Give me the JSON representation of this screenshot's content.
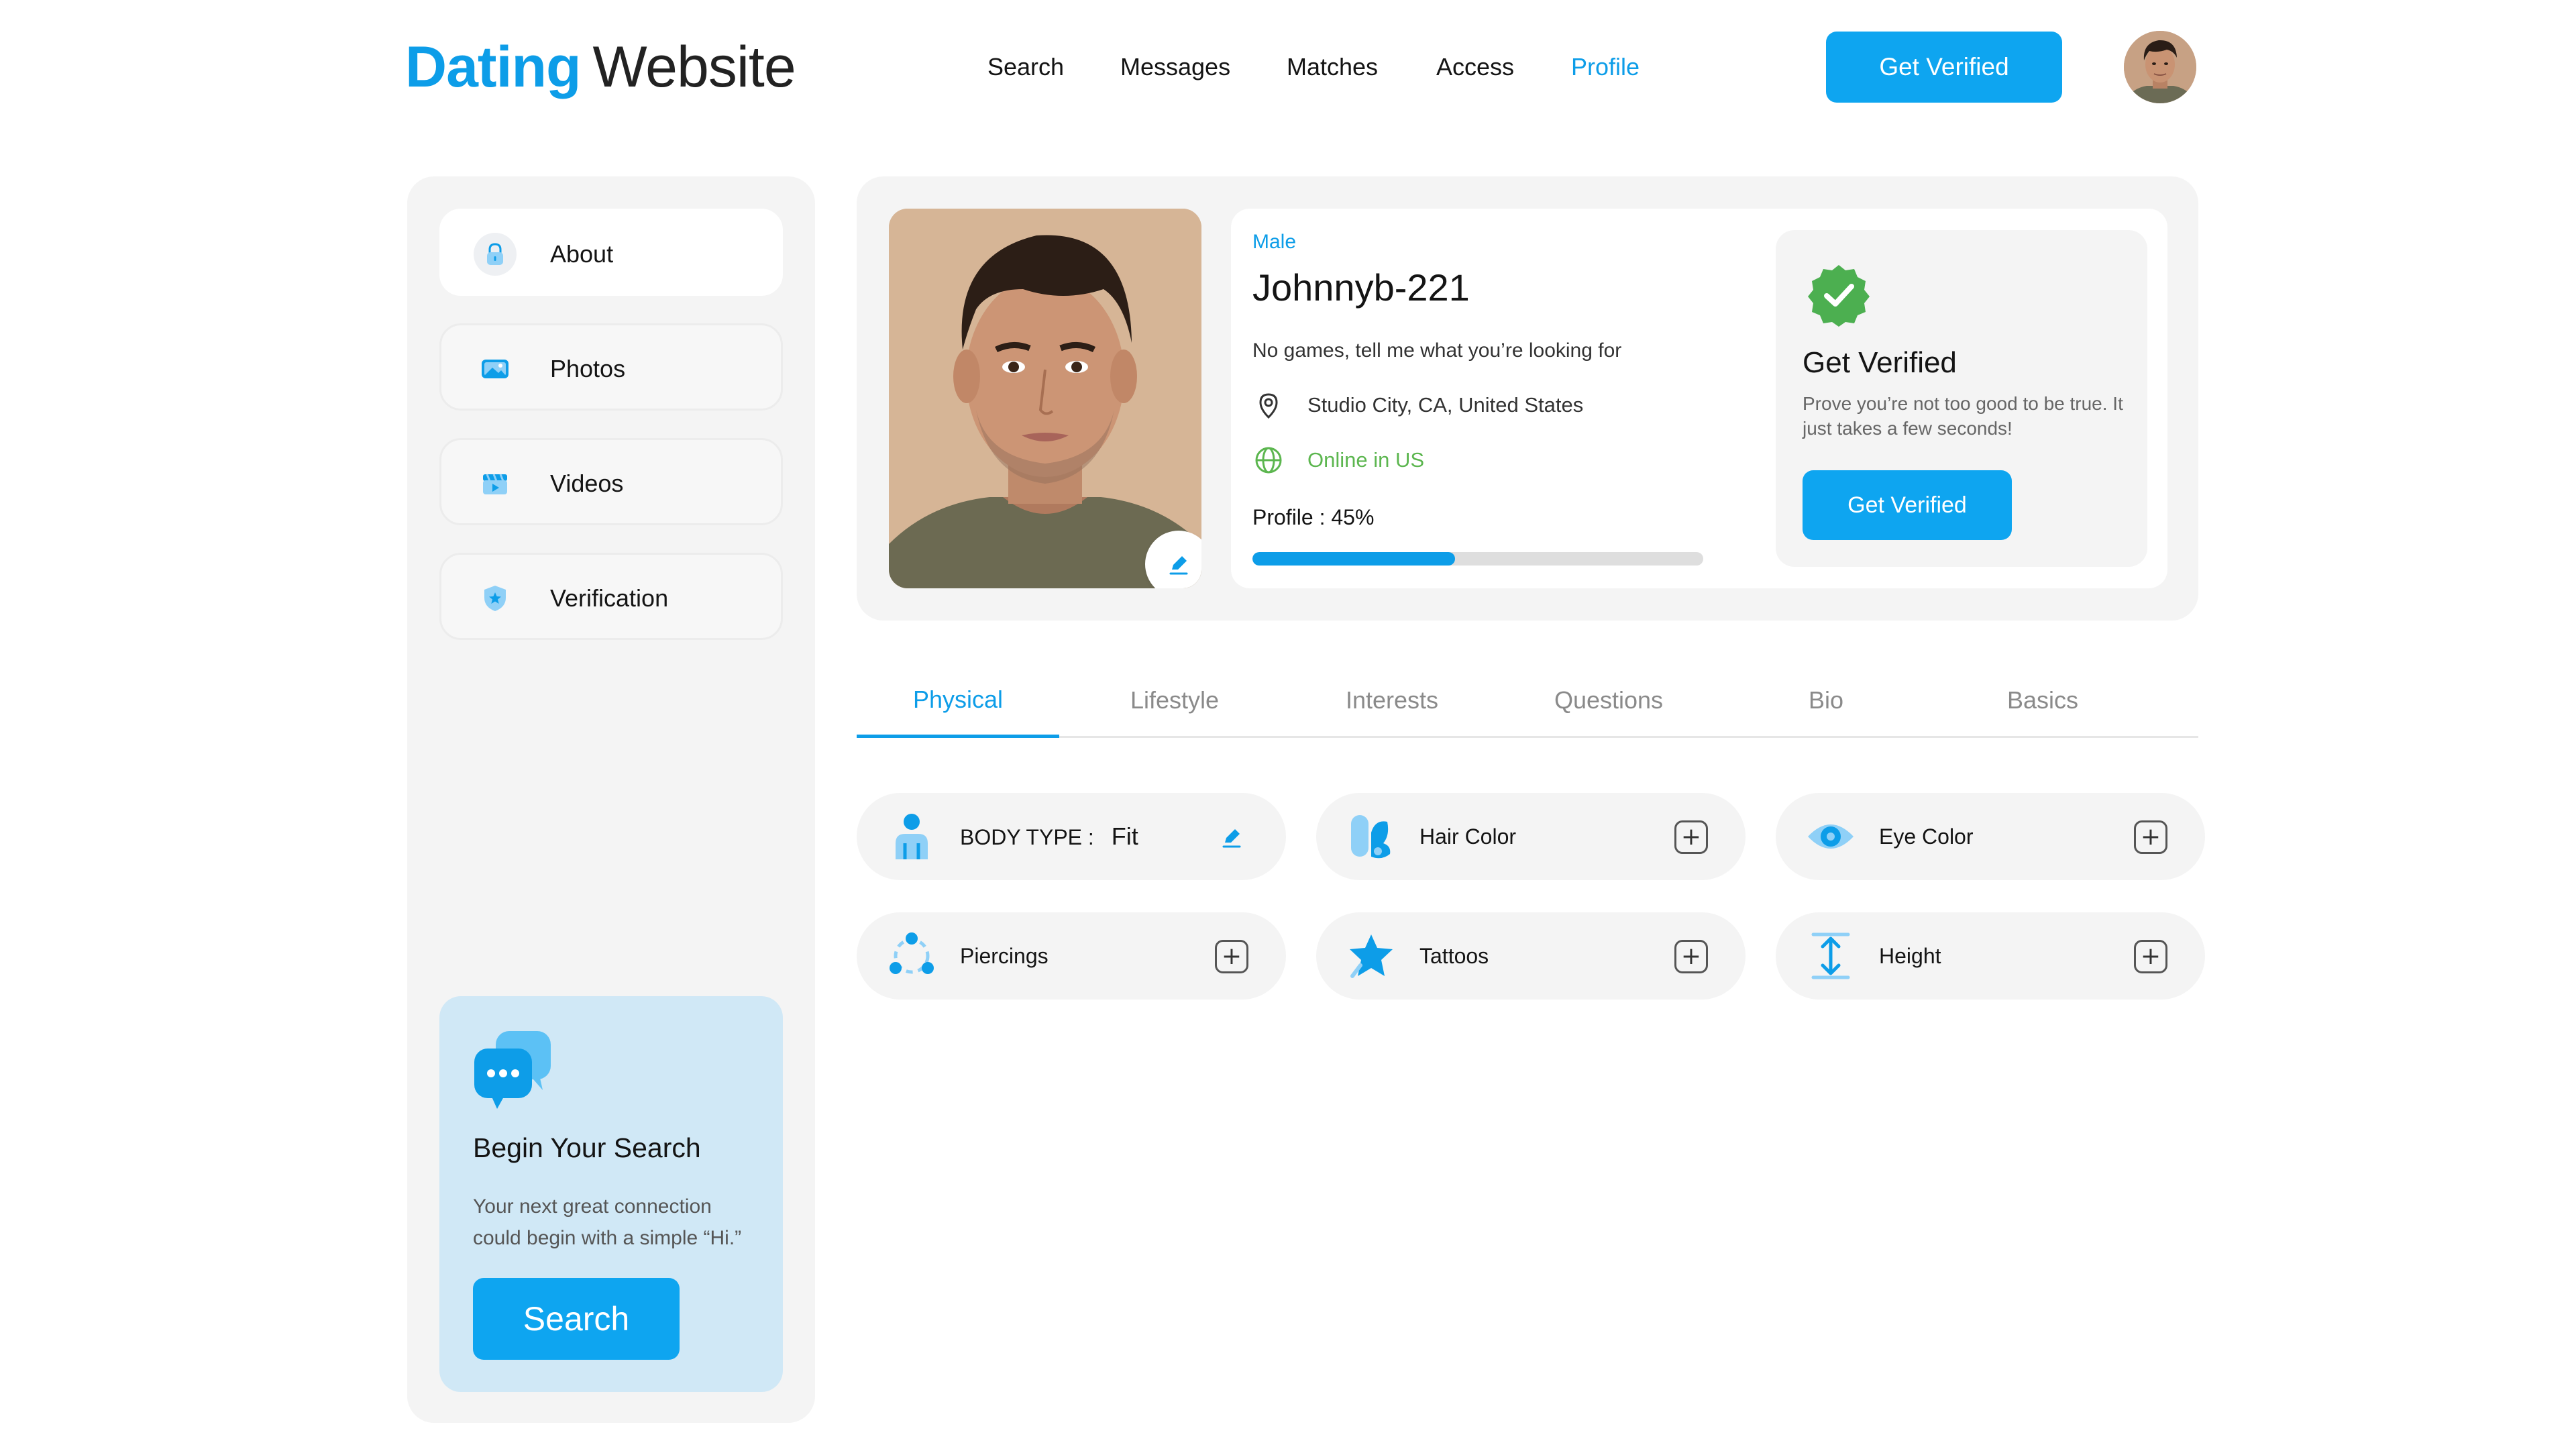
{
  "header": {
    "logo_bold": "Dating",
    "logo_light": "Website",
    "nav": [
      "Search",
      "Messages",
      "Matches",
      "Access",
      "Profile"
    ],
    "active_nav": "Profile",
    "cta_label": "Get Verified",
    "avatar_icon": "user-avatar"
  },
  "sidebar": {
    "items": [
      {
        "label": "About",
        "icon": "lock-icon"
      },
      {
        "label": "Photos",
        "icon": "image-icon"
      },
      {
        "label": "Videos",
        "icon": "video-icon"
      },
      {
        "label": "Verification",
        "icon": "shield-icon"
      }
    ],
    "promo": {
      "icon": "chat-bubbles-icon",
      "title": "Begin Your Search",
      "text": "Your next great connection could begin with a simple “Hi.”",
      "button_label": "Search"
    }
  },
  "profile": {
    "gender": "Male",
    "username": "Johnnyb-221",
    "tagline": "No games, tell me what you’re looking for",
    "location": "Studio City, CA, United States",
    "status": "Online in US",
    "progress_label": "Profile : 45%",
    "progress_value": 0.45,
    "photo_edit_icon": "pencil-icon"
  },
  "verify": {
    "title": "Get Verified",
    "text": "Prove you’re not too good to be true. It just takes a few seconds!",
    "button_label": "Get Verified",
    "badge_icon": "verified-badge-icon"
  },
  "tabs": [
    "Physical",
    "Lifestyle",
    "Interests",
    "Questions",
    "Bio",
    "Basics"
  ],
  "active_tab": "Physical",
  "attributes": [
    {
      "label": "BODY TYPE :",
      "value": "Fit",
      "icon": "person-icon",
      "action": "edit"
    },
    {
      "label": "Hair Color",
      "value": "",
      "icon": "hair-icon",
      "action": "add"
    },
    {
      "label": "Eye Color",
      "value": "",
      "icon": "eye-icon",
      "action": "add"
    },
    {
      "label": "Piercings",
      "value": "",
      "icon": "piercing-icon",
      "action": "add"
    },
    {
      "label": "Tattoos",
      "value": "",
      "icon": "tattoo-icon",
      "action": "add"
    },
    {
      "label": "Height",
      "value": "",
      "icon": "height-icon",
      "action": "add"
    }
  ],
  "colors": {
    "accent": "#0d9de8",
    "button": "#0ea5f0",
    "online": "#5cb64f",
    "verified_badge": "#4caf50",
    "promo_bg": "#d0e8f6",
    "panel_bg": "#f4f4f4"
  }
}
